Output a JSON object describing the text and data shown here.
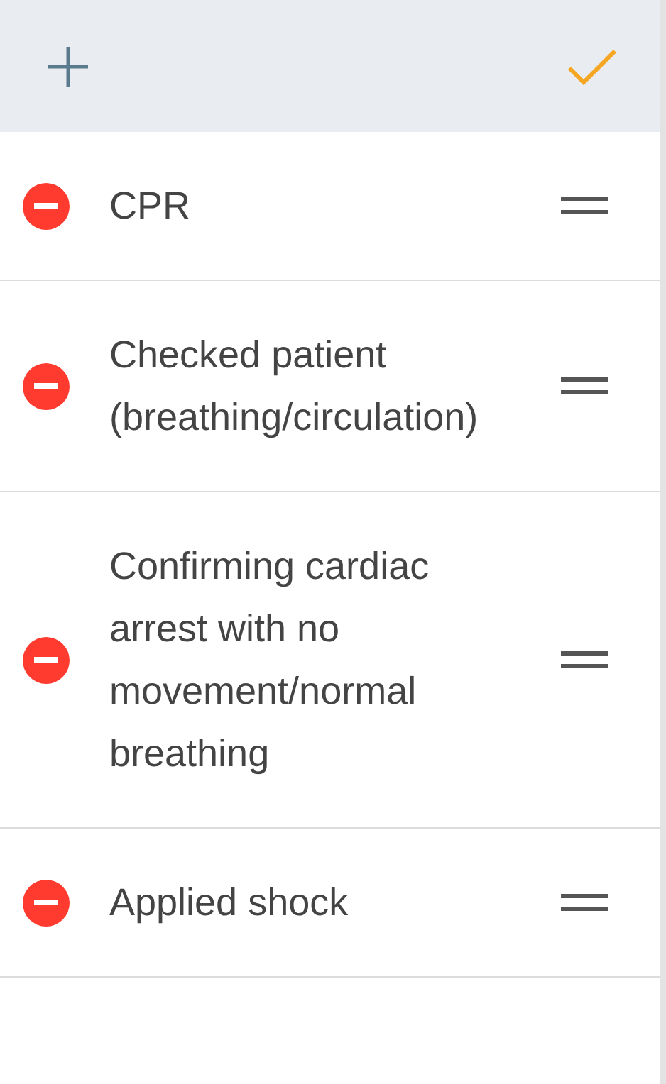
{
  "items": [
    {
      "label": "CPR"
    },
    {
      "label": "Checked patient (breathing/circulation)"
    },
    {
      "label": "Confirming cardiac arrest with no movement/normal breathing"
    },
    {
      "label": "Applied shock"
    }
  ]
}
